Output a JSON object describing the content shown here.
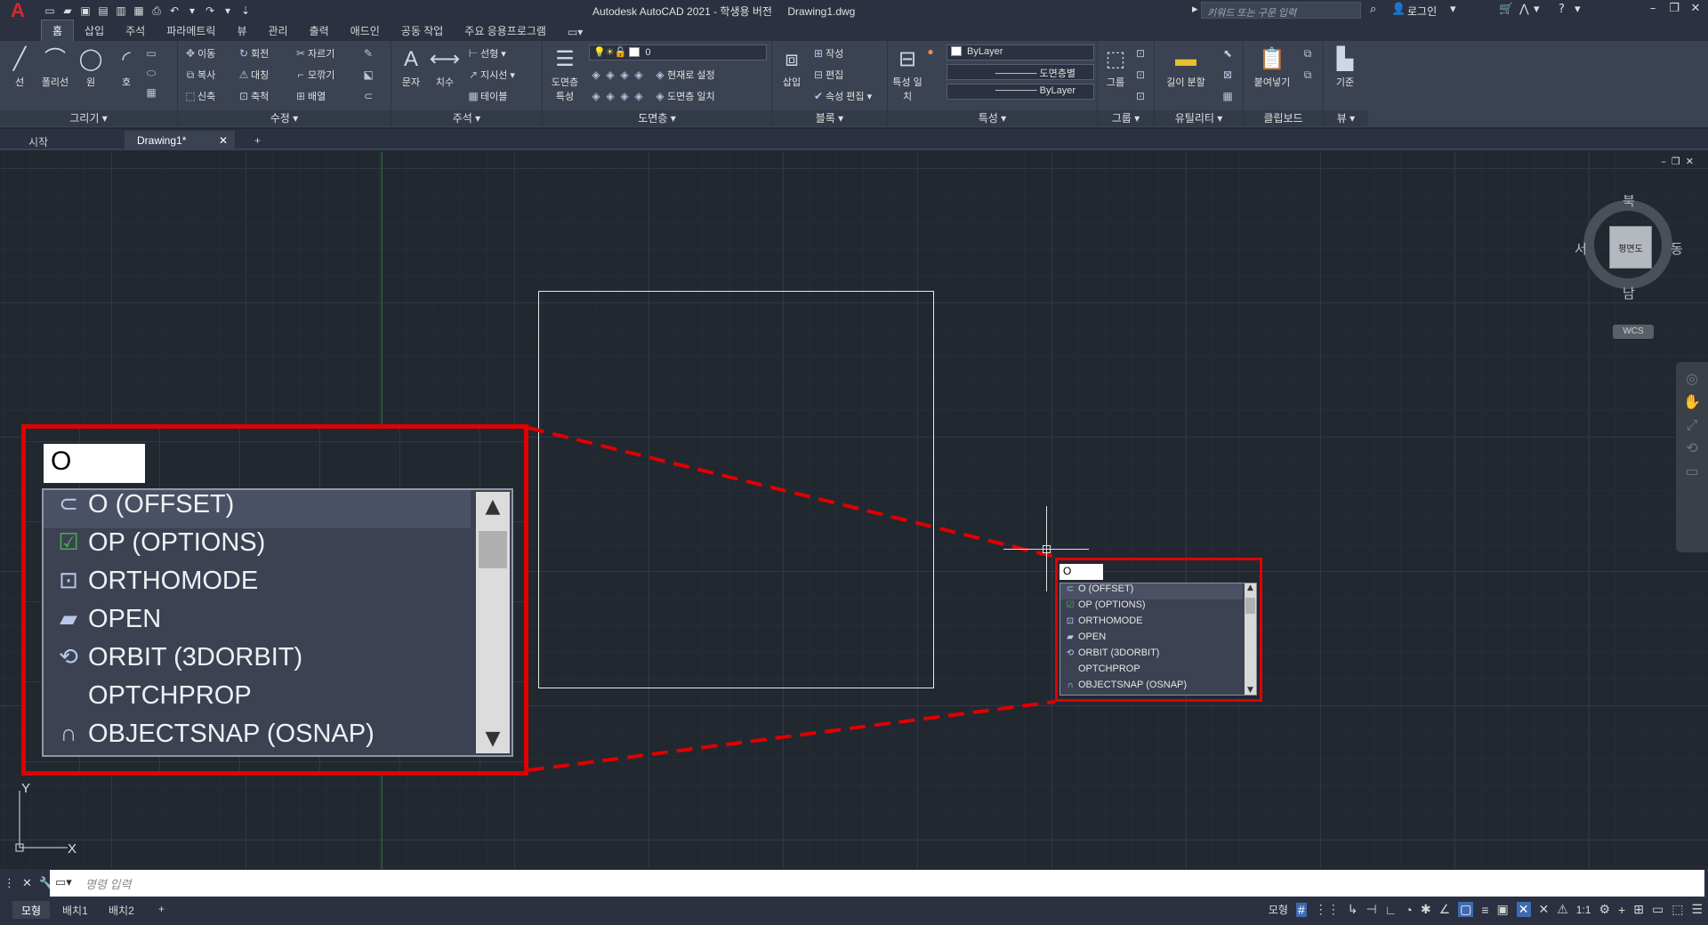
{
  "app": {
    "title": "Autodesk AutoCAD 2021 - 학생용 버전",
    "document": "Drawing1.dwg",
    "search_placeholder": "키워드 또는 구문 입력",
    "login": "로그인"
  },
  "ribbon_tabs": [
    "홈",
    "삽입",
    "주석",
    "파라메트릭",
    "뷰",
    "관리",
    "출력",
    "애드인",
    "공동 작업",
    "주요 응용프로그램"
  ],
  "ribbon": {
    "draw": {
      "label": "그리기 ▾",
      "line": "선",
      "polyline": "폴리선",
      "circle": "원",
      "arc": "호"
    },
    "modify": {
      "label": "수정 ▾",
      "move": "이동",
      "rotate": "회전",
      "trim": "자르기",
      "copy": "복사",
      "mirror": "대칭",
      "fillet": "모깎기",
      "stretch": "신축",
      "scale": "축척",
      "array": "배열"
    },
    "annotation": {
      "label": "주석 ▾",
      "text": "문자",
      "dimension": "치수",
      "linear": "선형",
      "leader": "지시선",
      "table": "테이블"
    },
    "layers": {
      "label": "도면층 ▾",
      "properties": "도면층 특성",
      "current_layer": "0",
      "make_current": "현재로 설정",
      "match": "도면층 일치"
    },
    "block": {
      "label": "블록 ▾",
      "insert": "삽입",
      "create": "작성",
      "edit": "편집",
      "edit_attributes": "속성 편집"
    },
    "properties": {
      "label": "특성 ▾",
      "match": "특성 일치",
      "color": "ByLayer",
      "linetype": "도면층별",
      "lineweight": "ByLayer"
    },
    "groups": {
      "label": "그룹 ▾",
      "group": "그룹"
    },
    "utilities": {
      "label": "유틸리티 ▾",
      "measure": "길이 분할"
    },
    "clipboard": {
      "label": "클립보드",
      "paste": "붙여넣기"
    },
    "view": {
      "label": "뷰 ▾",
      "base": "기준"
    }
  },
  "file_tabs": {
    "start": "시작",
    "drawing": "Drawing1*"
  },
  "viewcube": {
    "north": "북",
    "south": "남",
    "east": "동",
    "west": "서",
    "face": "평면도",
    "wcs": "WCS"
  },
  "autocomplete": {
    "typed": "O",
    "items": [
      {
        "icon": "offset-icon",
        "label": "O (OFFSET)"
      },
      {
        "icon": "options-check-icon",
        "label": "OP (OPTIONS)"
      },
      {
        "icon": "variable-icon",
        "label": "ORTHOMODE"
      },
      {
        "icon": "folder-open-icon",
        "label": "OPEN"
      },
      {
        "icon": "orbit-icon",
        "label": "ORBIT (3DORBIT)"
      },
      {
        "icon": "",
        "label": "OPTCHPROP"
      },
      {
        "icon": "magnet-snap-icon",
        "label": "OBJECTSNAP (OSNAP)"
      }
    ]
  },
  "ucs": {
    "y": "Y",
    "x": "X"
  },
  "command_line": {
    "placeholder": "명령 입력"
  },
  "layout_tabs": [
    "모형",
    "배치1",
    "배치2"
  ],
  "status": {
    "model": "모형",
    "scale": "1:1"
  }
}
